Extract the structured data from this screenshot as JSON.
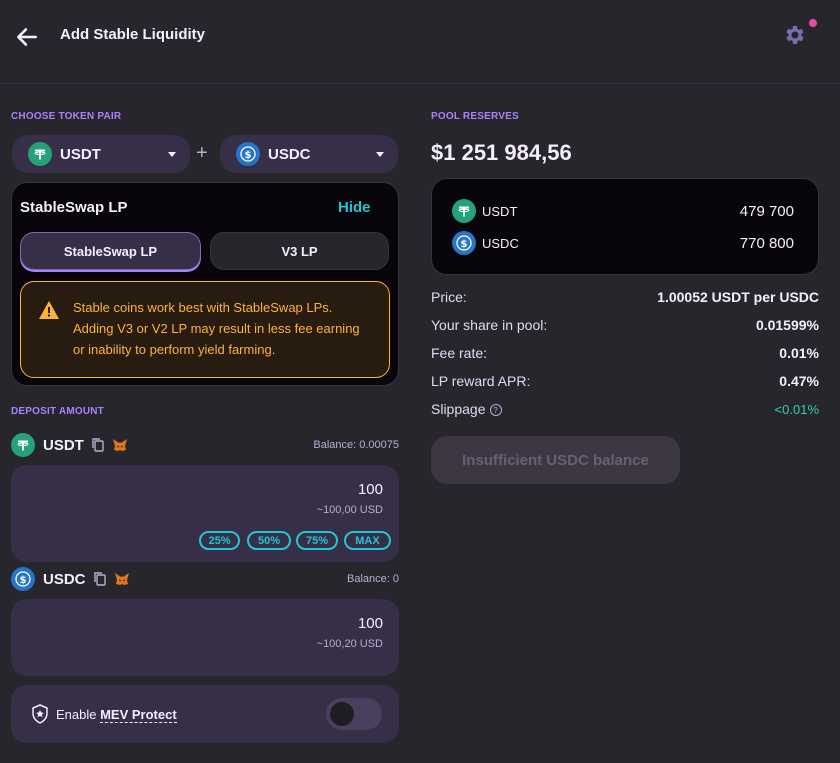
{
  "header": {
    "title": "Add Stable Liquidity",
    "back_icon": "arrow-left-icon",
    "settings_icon": "gear-icon"
  },
  "choose_pair": {
    "label": "CHOOSE TOKEN PAIR",
    "token_a": "USDT",
    "token_b": "USDC",
    "plus": "+"
  },
  "lp_card": {
    "title": "StableSwap LP",
    "hide_label": "Hide",
    "tabs": [
      "StableSwap LP",
      "V3 LP"
    ],
    "active_tab": "StableSwap LP",
    "warning": "Stable coins work best with StableSwap LPs. Adding V3 or V2 LP may result in less fee earning or inability to perform yield farming."
  },
  "deposit": {
    "label": "DEPOSIT AMOUNT",
    "token_a": {
      "symbol": "USDT",
      "balance": "Balance: 0.00075",
      "amount": "100",
      "usd": "~100,00 USD"
    },
    "token_b": {
      "symbol": "USDC",
      "balance": "Balance: 0",
      "amount": "100",
      "usd": "~100,20 USD"
    },
    "percent_buttons": [
      "25%",
      "50%",
      "75%",
      "MAX"
    ]
  },
  "mev": {
    "prefix": "Enable ",
    "link": "MEV Protect",
    "enabled": false
  },
  "pool": {
    "label": "POOL RESERVES",
    "total": "$1 251 984,56",
    "reserves": [
      {
        "symbol": "USDT",
        "value": "479 700"
      },
      {
        "symbol": "USDC",
        "value": "770 800"
      }
    ],
    "stats": [
      {
        "label": "Price:",
        "value": "1.00052 USDT per USDC"
      },
      {
        "label": "Your share in pool:",
        "value": "0.01599%"
      },
      {
        "label": "Fee rate:",
        "value": "0.01%"
      },
      {
        "label": "LP reward APR:",
        "value": "0.47%"
      },
      {
        "label": "Slippage",
        "value": "<0.01%"
      }
    ],
    "submit_label": "Insufficient USDC balance"
  },
  "colors": {
    "accent": "#1fc7d4",
    "purple": "#a881fc",
    "warning": "#ffb237",
    "success": "#31d0aa",
    "background": "#27262c"
  }
}
